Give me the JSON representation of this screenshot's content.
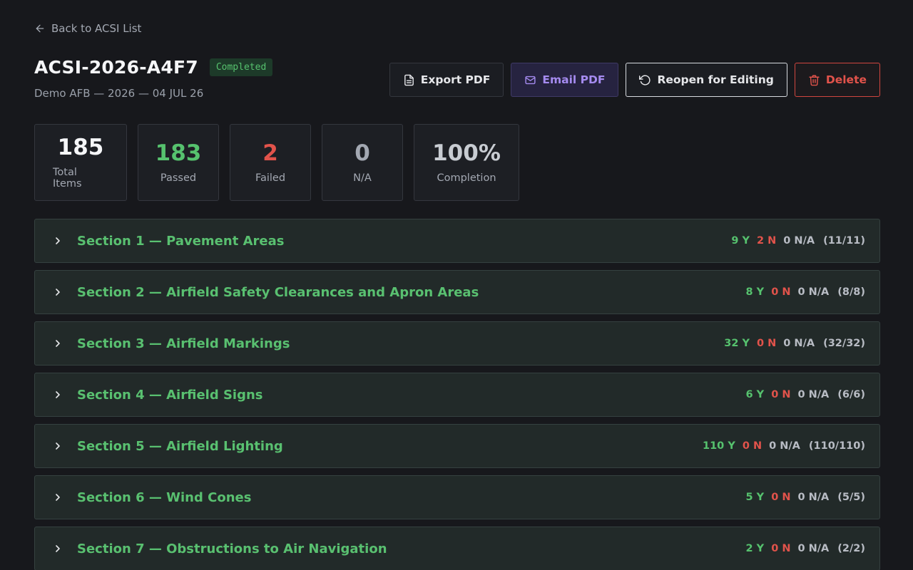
{
  "nav": {
    "back_label": "Back to ACSI List"
  },
  "header": {
    "title": "ACSI-2026-A4F7",
    "status": "Completed",
    "subtitle": "Demo AFB — 2026 — 04 JUL 26"
  },
  "actions": {
    "export_pdf": "Export PDF",
    "email_pdf": "Email PDF",
    "reopen": "Reopen for Editing",
    "delete": "Delete"
  },
  "stats": {
    "total": {
      "value": "185",
      "label": "Total Items"
    },
    "passed": {
      "value": "183",
      "label": "Passed"
    },
    "failed": {
      "value": "2",
      "label": "Failed"
    },
    "na": {
      "value": "0",
      "label": "N/A"
    },
    "completion": {
      "value": "100%",
      "label": "Completion"
    }
  },
  "sections": [
    {
      "title": "Section 1 — Pavement Areas",
      "yes": "9 Y",
      "no": "2 N",
      "na": "0 N/A",
      "total": "(11/11)"
    },
    {
      "title": "Section 2 — Airfield Safety Clearances and Apron Areas",
      "yes": "8 Y",
      "no": "0 N",
      "na": "0 N/A",
      "total": "(8/8)"
    },
    {
      "title": "Section 3 — Airfield Markings",
      "yes": "32 Y",
      "no": "0 N",
      "na": "0 N/A",
      "total": "(32/32)"
    },
    {
      "title": "Section 4 — Airfield Signs",
      "yes": "6 Y",
      "no": "0 N",
      "na": "0 N/A",
      "total": "(6/6)"
    },
    {
      "title": "Section 5 — Airfield Lighting",
      "yes": "110 Y",
      "no": "0 N",
      "na": "0 N/A",
      "total": "(110/110)"
    },
    {
      "title": "Section 6 — Wind Cones",
      "yes": "5 Y",
      "no": "0 N",
      "na": "0 N/A",
      "total": "(5/5)"
    },
    {
      "title": "Section 7 — Obstructions to Air Navigation",
      "yes": "2 Y",
      "no": "0 N",
      "na": "0 N/A",
      "total": "(2/2)"
    }
  ],
  "colors": {
    "background": "#17181c",
    "pass": "#56c26e",
    "fail": "#e2534b",
    "accent_email": "#a58bf0"
  },
  "icons": {
    "back": "arrow-left-icon",
    "export": "file-icon",
    "email": "mail-icon",
    "reopen": "rotate-ccw-icon",
    "delete": "trash-icon",
    "section": "chevron-right-icon"
  }
}
